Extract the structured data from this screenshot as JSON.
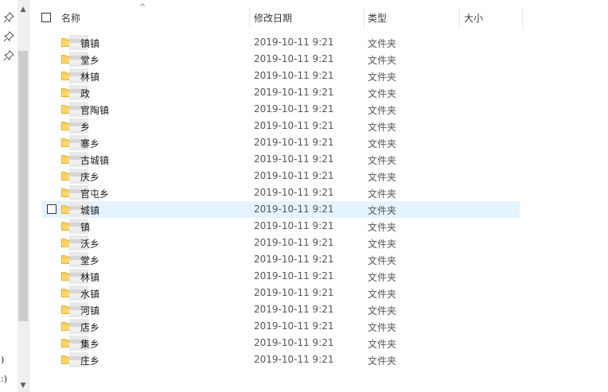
{
  "nav": {
    "fragments": [
      ")",
      ":)"
    ]
  },
  "header": {
    "columns": [
      {
        "label": "名称"
      },
      {
        "label": "修改日期"
      },
      {
        "label": "类型"
      },
      {
        "label": "大小"
      }
    ]
  },
  "files": [
    {
      "name": "镇镇",
      "modified": "2019-10-11 9:21",
      "type": "文件夹",
      "selected": false
    },
    {
      "name": "堂乡",
      "modified": "2019-10-11 9:21",
      "type": "文件夹",
      "selected": false
    },
    {
      "name": "林镇",
      "modified": "2019-10-11 9:21",
      "type": "文件夹",
      "selected": false
    },
    {
      "name": "政",
      "modified": "2019-10-11 9:21",
      "type": "文件夹",
      "selected": false
    },
    {
      "name": "官陶镇",
      "modified": "2019-10-11 9:21",
      "type": "文件夹",
      "selected": false
    },
    {
      "name": "乡",
      "modified": "2019-10-11 9:21",
      "type": "文件夹",
      "selected": false
    },
    {
      "name": "寨乡",
      "modified": "2019-10-11 9:21",
      "type": "文件夹",
      "selected": false
    },
    {
      "name": "古城镇",
      "modified": "2019-10-11 9:21",
      "type": "文件夹",
      "selected": false
    },
    {
      "name": "庆乡",
      "modified": "2019-10-11 9:21",
      "type": "文件夹",
      "selected": false
    },
    {
      "name": "官屯乡",
      "modified": "2019-10-11 9:21",
      "type": "文件夹",
      "selected": false
    },
    {
      "name": "城镇",
      "modified": "2019-10-11 9:21",
      "type": "文件夹",
      "selected": true
    },
    {
      "name": "镇",
      "modified": "2019-10-11 9:21",
      "type": "文件夹",
      "selected": false
    },
    {
      "name": "沃乡",
      "modified": "2019-10-11 9:21",
      "type": "文件夹",
      "selected": false
    },
    {
      "name": "堂乡",
      "modified": "2019-10-11 9:21",
      "type": "文件夹",
      "selected": false
    },
    {
      "name": "林镇",
      "modified": "2019-10-11 9:21",
      "type": "文件夹",
      "selected": false
    },
    {
      "name": "水镇",
      "modified": "2019-10-11 9:21",
      "type": "文件夹",
      "selected": false
    },
    {
      "name": "河镇",
      "modified": "2019-10-11 9:21",
      "type": "文件夹",
      "selected": false
    },
    {
      "name": "店乡",
      "modified": "2019-10-11 9:21",
      "type": "文件夹",
      "selected": false
    },
    {
      "name": "集乡",
      "modified": "2019-10-11 9:21",
      "type": "文件夹",
      "selected": false
    },
    {
      "name": "庄乡",
      "modified": "2019-10-11 9:21",
      "type": "文件夹",
      "selected": false
    }
  ],
  "colors": {
    "selection": "#e5f3ff",
    "folder": "#ffd766"
  }
}
